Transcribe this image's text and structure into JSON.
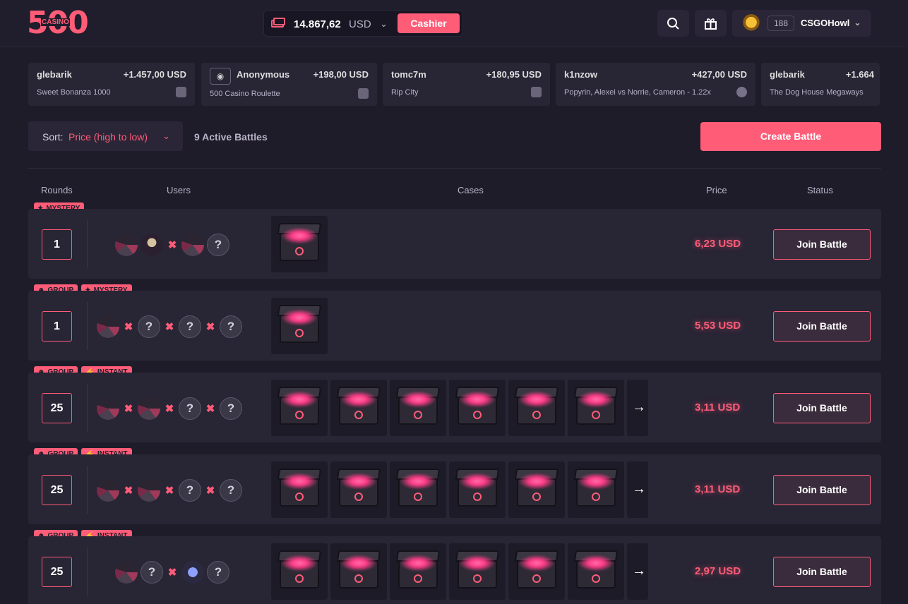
{
  "header": {
    "logo_main": "500",
    "logo_sub": "CASINO",
    "balance_amount": "14.867,62",
    "balance_currency": "USD",
    "cashier_label": "Cashier",
    "search_icon": "search-icon",
    "gift_icon": "gift-icon",
    "user_level": "188",
    "username": "CSGOHowl"
  },
  "ticker": [
    {
      "name": "glebarik",
      "amount": "+1.457,00 USD",
      "game": "Sweet Bonanza 1000",
      "icon": "cards-icon"
    },
    {
      "name": "Anonymous",
      "amount": "+198,00 USD",
      "game": "500 Casino Roulette",
      "icon": "cards-icon"
    },
    {
      "name": "tomc7m",
      "amount": "+180,95 USD",
      "game": "Rip City",
      "icon": "cards-icon"
    },
    {
      "name": "k1nzow",
      "amount": "+427,00 USD",
      "game": "Popyrin, Alexei vs Norrie, Cameron - 1.22x",
      "icon": "ball-icon"
    },
    {
      "name": "glebarik",
      "amount": "+1.664",
      "game": "The Dog House Megaways",
      "icon": "cards-icon"
    }
  ],
  "controls": {
    "sort_label": "Sort:",
    "sort_value": "Price (high to low)",
    "active_battles": "9 Active Battles",
    "create_label": "Create Battle"
  },
  "table_headers": {
    "rounds": "Rounds",
    "users": "Users",
    "cases": "Cases",
    "price": "Price",
    "status": "Status"
  },
  "battles": [
    {
      "tags": [
        "MYSTERY"
      ],
      "rounds": "1",
      "price": "6,23 USD",
      "action": "Join Battle"
    },
    {
      "tags": [
        "GROUP",
        "MYSTERY"
      ],
      "rounds": "1",
      "price": "5,53 USD",
      "action": "Join Battle"
    },
    {
      "tags": [
        "GROUP",
        "INSTANT"
      ],
      "rounds": "25",
      "price": "3,11 USD",
      "action": "Join Battle"
    },
    {
      "tags": [
        "GROUP",
        "INSTANT"
      ],
      "rounds": "25",
      "price": "3,11 USD",
      "action": "Join Battle"
    },
    {
      "tags": [
        "GROUP",
        "INSTANT"
      ],
      "rounds": "25",
      "price": "2,97 USD",
      "action": "Join Battle"
    }
  ],
  "colors": {
    "accent": "#ff5c78",
    "background": "#1f1c2a",
    "row": "#282535"
  }
}
